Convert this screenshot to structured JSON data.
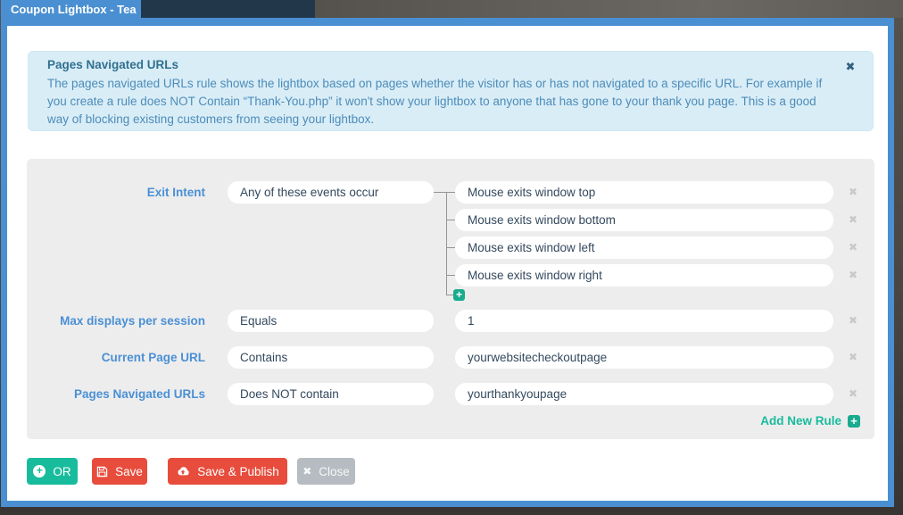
{
  "window": {
    "tab_title": "Coupon Lightbox - Tea"
  },
  "alert": {
    "title": "Pages Navigated URLs",
    "body": "The pages navigated URLs rule shows the lightbox based on pages whether the visitor has or has not navigated to a specific URL. For example if you create a rule does NOT Contain “Thank-You.php” it won't show your lightbox to anyone that has gone to your thank you page. This is a good way of blocking existing customers from seeing your lightbox.",
    "close_icon": "✖"
  },
  "rules": [
    {
      "label": "Exit Intent",
      "condition": "Any of these events occur",
      "values": [
        "Mouse exits window top",
        "Mouse exits window bottom",
        "Mouse exits window left",
        "Mouse exits window right"
      ]
    },
    {
      "label": "Max displays per session",
      "condition": "Equals",
      "values": [
        "1"
      ]
    },
    {
      "label": "Current Page URL",
      "condition": "Contains",
      "values": [
        "yourwebsitecheckoutpage"
      ]
    },
    {
      "label": "Pages Navigated URLs",
      "condition": "Does NOT contain",
      "values": [
        "yourthankyoupage"
      ]
    }
  ],
  "icons": {
    "remove": "✖",
    "plus": "+",
    "close_btn": "✖"
  },
  "add_new_rule": {
    "label": "Add New Rule"
  },
  "footer": {
    "or_label": "OR",
    "save_label": "Save",
    "save_publish_label": "Save & Publish",
    "close_label": "Close"
  },
  "colors": {
    "accent_blue": "#4a8fd1",
    "label_blue": "#4a90d5",
    "teal": "#18bc9c",
    "red": "#e74c3c",
    "close_gray": "#b6bcc2",
    "alert_bg": "#d9edf7",
    "alert_text": "#31708f",
    "panel_bg": "#ededed",
    "navy": "#23374a"
  }
}
